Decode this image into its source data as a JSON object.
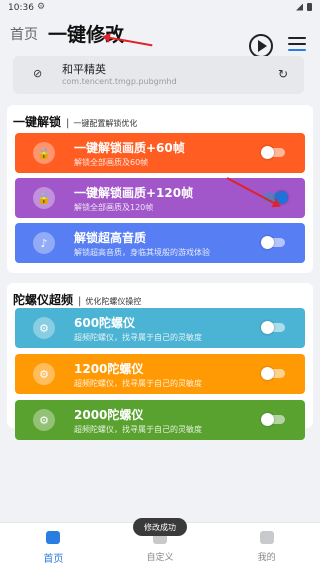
{
  "status_bar": {
    "time": "10:36"
  },
  "header": {
    "home_tab": "首页",
    "title": "一键修改",
    "play_icon": "play-circle-icon",
    "menu_icon": "hamburger-menu-icon"
  },
  "target_app": {
    "name": "和平精英",
    "package": "com.tencent.tmgp.pubgmhd",
    "icon": "disabled-vibrate-icon",
    "refresh_icon": "refresh-icon"
  },
  "unlock_section": {
    "title": "一键解锁",
    "separator": "|",
    "subtitle": "一键配置解锁优化",
    "cards": [
      {
        "title": "一键解锁画质+60帧",
        "desc": "解锁全部画质及60帧",
        "color": "#ff5d21",
        "icon": "lock-icon",
        "enabled": false
      },
      {
        "title": "一键解锁画质+120帧",
        "desc": "解锁全部画质及120帧",
        "color": "#a156c9",
        "icon": "lock-icon",
        "enabled": true
      },
      {
        "title": "解锁超高音质",
        "desc": "解锁超高音质，身临其境般的游戏体验",
        "color": "#577ef3",
        "icon": "music-disc-icon",
        "enabled": false
      }
    ]
  },
  "gyro_section": {
    "title": "陀螺仪超频",
    "separator": "|",
    "subtitle": "优化陀螺仪操控",
    "cards": [
      {
        "title": "600陀螺仪",
        "desc": "超频陀螺仪，找寻属于自己的灵敏度",
        "color": "#4bb3d3",
        "icon": "gear-icon",
        "enabled": false
      },
      {
        "title": "1200陀螺仪",
        "desc": "超频陀螺仪，找寻属于自己的灵敏度",
        "color": "#ff9a05",
        "icon": "gear-icon",
        "enabled": false
      },
      {
        "title": "2000陀螺仪",
        "desc": "超频陀螺仪，找寻属于自己的灵敏度",
        "color": "#5aa22f",
        "icon": "gear-icon",
        "enabled": false
      }
    ]
  },
  "toast": "修改成功",
  "bottom_nav": {
    "items": [
      {
        "label": "首页",
        "active": true
      },
      {
        "label": "自定义",
        "active": false
      },
      {
        "label": "我的",
        "active": false
      }
    ]
  },
  "annotation_color": "#e0222a",
  "accent_color": "#2a7de1"
}
